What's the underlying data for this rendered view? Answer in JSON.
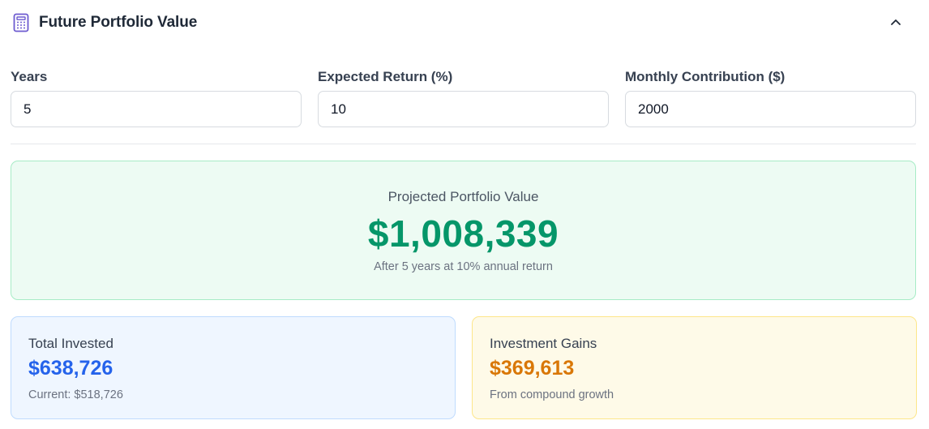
{
  "header": {
    "title": "Future Portfolio Value",
    "icon": "calculator-icon",
    "collapse_icon": "chevron-up-icon",
    "accent_color": "#6d5bd0"
  },
  "inputs": {
    "years": {
      "label": "Years",
      "value": "5"
    },
    "expected_return": {
      "label": "Expected Return (%)",
      "value": "10"
    },
    "monthly_contribution": {
      "label": "Monthly Contribution ($)",
      "value": "2000"
    }
  },
  "projected": {
    "label": "Projected Portfolio Value",
    "value": "$1,008,339",
    "subtitle": "After 5 years at 10% annual return",
    "color": "#059669"
  },
  "total_invested": {
    "label": "Total Invested",
    "value": "$638,726",
    "subtitle": "Current: $518,726",
    "color": "#2563eb"
  },
  "investment_gains": {
    "label": "Investment Gains",
    "value": "$369,613",
    "subtitle": "From compound growth",
    "color": "#d97706"
  }
}
